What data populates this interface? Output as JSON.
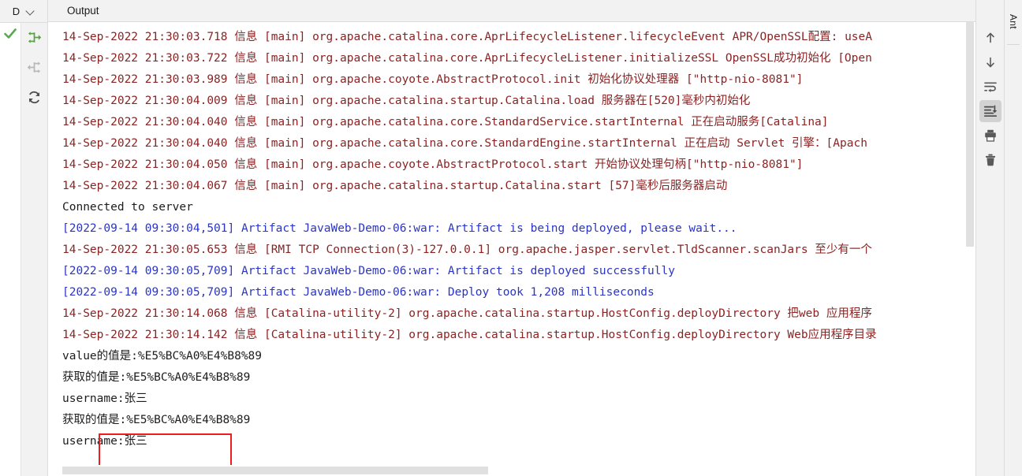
{
  "left_rail": {
    "header_label": "D",
    "header_chevron_icon": "chevron-down-icon",
    "status_icon": "green-check-icon",
    "buttons": [
      {
        "name": "rerun-icon",
        "title": "Rerun",
        "enabled": true
      },
      {
        "name": "step-back-icon",
        "title": "Previous",
        "enabled": false
      },
      {
        "name": "refresh-icon",
        "title": "Refresh",
        "enabled": true
      }
    ]
  },
  "tabs": {
    "active": "Output",
    "items": [
      "Output"
    ]
  },
  "console": {
    "lines": [
      {
        "kind": "info",
        "text": "14-Sep-2022 21:30:03.718 信息 [main] org.apache.catalina.core.AprLifecycleListener.lifecycleEvent APR/OpenSSL配置: useA"
      },
      {
        "kind": "info",
        "text": "14-Sep-2022 21:30:03.722 信息 [main] org.apache.catalina.core.AprLifecycleListener.initializeSSL OpenSSL成功初始化 [Open"
      },
      {
        "kind": "info",
        "text": "14-Sep-2022 21:30:03.989 信息 [main] org.apache.coyote.AbstractProtocol.init 初始化协议处理器 [\"http-nio-8081\"]"
      },
      {
        "kind": "info",
        "text": "14-Sep-2022 21:30:04.009 信息 [main] org.apache.catalina.startup.Catalina.load 服务器在[520]毫秒内初始化"
      },
      {
        "kind": "info",
        "text": "14-Sep-2022 21:30:04.040 信息 [main] org.apache.catalina.core.StandardService.startInternal 正在启动服务[Catalina]"
      },
      {
        "kind": "info",
        "text": "14-Sep-2022 21:30:04.040 信息 [main] org.apache.catalina.core.StandardEngine.startInternal 正在启动 Servlet 引擎：[Apach"
      },
      {
        "kind": "info",
        "text": "14-Sep-2022 21:30:04.050 信息 [main] org.apache.coyote.AbstractProtocol.start 开始协议处理句柄[\"http-nio-8081\"]"
      },
      {
        "kind": "info",
        "text": "14-Sep-2022 21:30:04.067 信息 [main] org.apache.catalina.startup.Catalina.start [57]毫秒后服务器启动"
      },
      {
        "kind": "plain",
        "text": "Connected to server"
      },
      {
        "kind": "art",
        "text": "[2022-09-14 09:30:04,501] Artifact JavaWeb-Demo-06:war: Artifact is being deployed, please wait..."
      },
      {
        "kind": "info",
        "text": "14-Sep-2022 21:30:05.653 信息 [RMI TCP Connection(3)-127.0.0.1] org.apache.jasper.servlet.TldScanner.scanJars 至少有一个"
      },
      {
        "kind": "art",
        "text": "[2022-09-14 09:30:05,709] Artifact JavaWeb-Demo-06:war: Artifact is deployed successfully"
      },
      {
        "kind": "art",
        "text": "[2022-09-14 09:30:05,709] Artifact JavaWeb-Demo-06:war: Deploy took 1,208 milliseconds"
      },
      {
        "kind": "info",
        "text": "14-Sep-2022 21:30:14.068 信息 [Catalina-utility-2] org.apache.catalina.startup.HostConfig.deployDirectory 把web 应用程序"
      },
      {
        "kind": "info",
        "text": "14-Sep-2022 21:30:14.142 信息 [Catalina-utility-2] org.apache.catalina.startup.HostConfig.deployDirectory Web应用程序目录"
      },
      {
        "kind": "plain",
        "text": "value的值是:%E5%BC%A0%E4%B8%89"
      },
      {
        "kind": "plain",
        "text": "获取的值是:%E5%BC%A0%E4%B8%89"
      },
      {
        "kind": "plain",
        "text": "username:张三"
      },
      {
        "kind": "plain",
        "text": "获取的值是:%E5%BC%A0%E4%B8%89"
      },
      {
        "kind": "plain",
        "text": "username:张三"
      }
    ],
    "highlight_color": "#ee1c1c"
  },
  "right_rail": {
    "buttons": [
      {
        "name": "scroll-up-icon",
        "title": "Up",
        "selected": false
      },
      {
        "name": "scroll-down-icon",
        "title": "Down",
        "selected": false
      },
      {
        "name": "soft-wrap-icon",
        "title": "Soft-Wrap",
        "selected": false
      },
      {
        "name": "scroll-to-end-icon",
        "title": "Scroll to End",
        "selected": true
      },
      {
        "name": "print-icon",
        "title": "Print",
        "selected": false
      },
      {
        "name": "trash-icon",
        "title": "Clear All",
        "selected": false
      }
    ]
  },
  "far_rail": {
    "vertical_tab_label": "Ant"
  },
  "colors": {
    "log_info": "#8b2323",
    "log_artifact": "#2a35c4",
    "log_plain": "#1c1c1c",
    "accent_green": "#57a64a",
    "highlight_red": "#ee1c1c"
  }
}
